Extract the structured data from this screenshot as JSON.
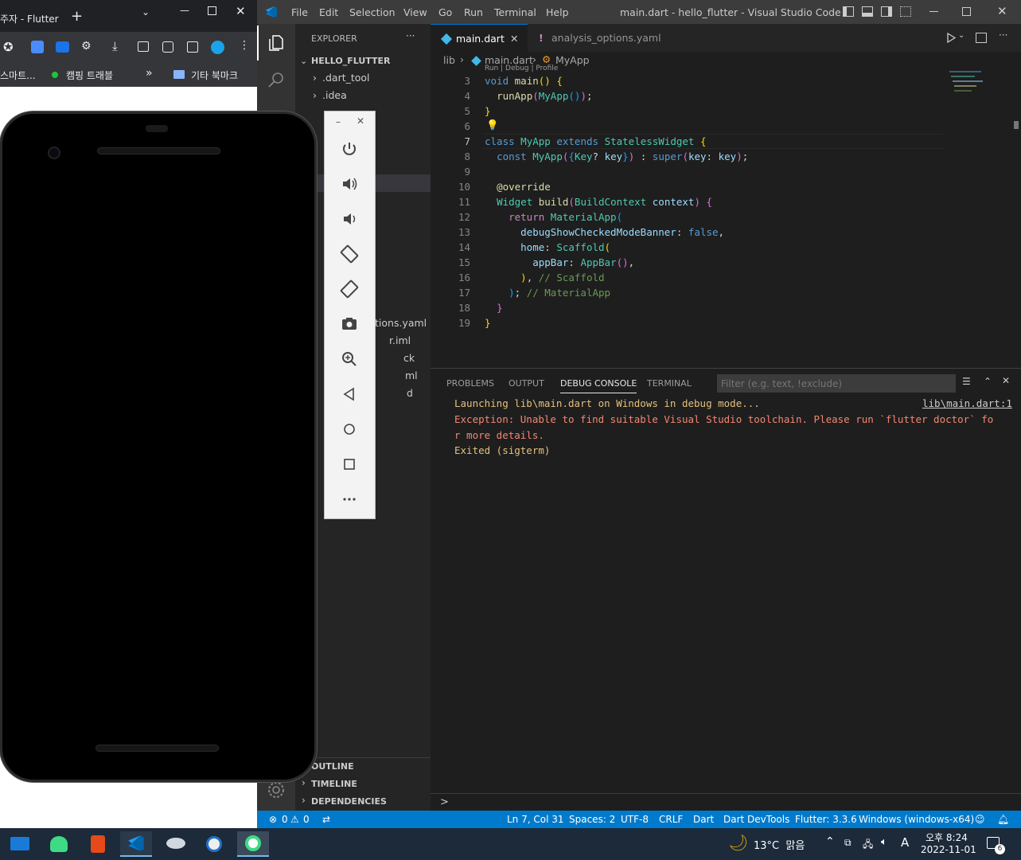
{
  "browser": {
    "tab_title": "주자 - Flutter",
    "new_tab": "+",
    "bookmark1": "스마트...",
    "bookmark2": "캠핑 트래블",
    "more": "»",
    "other_bookmarks": "기타 북마크"
  },
  "vscode": {
    "menu": [
      "File",
      "Edit",
      "Selection",
      "View",
      "Go",
      "Run",
      "Terminal",
      "Help"
    ],
    "window_title": "main.dart - hello_flutter - Visual Studio Code",
    "explorer": {
      "header": "EXPLORER",
      "more": "···",
      "project": "HELLO_FLUTTER",
      "items": [
        ".dart_tool",
        ".idea"
      ],
      "partial": [
        "tions.yaml",
        "r.iml",
        "ck",
        "ml",
        "d"
      ]
    },
    "outline": "OUTLINE",
    "timeline": "TIMELINE",
    "dependencies": "DEPENDENCIES",
    "tabs": [
      {
        "label": "main.dart",
        "active": true
      },
      {
        "label": "analysis_options.yaml",
        "active": false
      }
    ],
    "breadcrumb": [
      "lib",
      "main.dart",
      "MyApp"
    ],
    "code_lines": [
      "3",
      "4",
      "5",
      "6",
      "7",
      "8",
      "9",
      "10",
      "11",
      "12",
      "13",
      "14",
      "15",
      "16",
      "17",
      "18",
      "19"
    ],
    "codelens": "Run | Debug | Profile",
    "panel": {
      "tabs": [
        "PROBLEMS",
        "OUTPUT",
        "DEBUG CONSOLE",
        "TERMINAL"
      ],
      "active": "DEBUG CONSOLE",
      "filter_placeholder": "Filter (e.g. text, !exclude)",
      "lines": [
        "Launching lib\\main.dart on Windows in debug mode...",
        "Exception: Unable to find suitable Visual Studio toolchain. Please run `flutter doctor` fo",
        "r more details.",
        "Exited (sigterm)"
      ],
      "link": "lib\\main.dart:1",
      "prompt": ">"
    },
    "status": {
      "errors": "0",
      "warnings": "0",
      "position": "Ln 7, Col 31",
      "spaces": "Spaces: 2",
      "encoding": "UTF-8",
      "eol": "CRLF",
      "lang": "Dart",
      "devtools": "Dart DevTools",
      "flutter": "Flutter: 3.3.6",
      "device": "Windows (windows-x64)"
    }
  },
  "taskbar": {
    "weather": "13°C  맑음",
    "time": "오후 8:24",
    "date": "2022-11-01",
    "ime": "A",
    "notif": "6"
  },
  "colors": {
    "status": "#007acc",
    "accent": "#0078d4"
  }
}
